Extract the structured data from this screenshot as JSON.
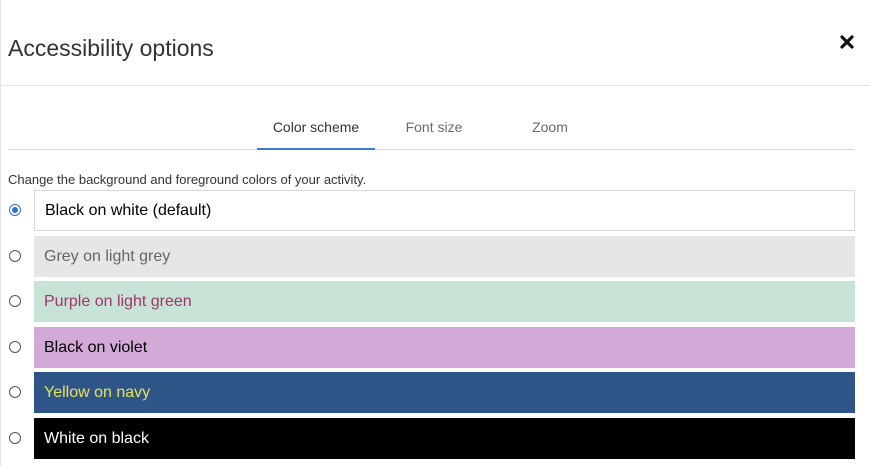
{
  "dialog": {
    "title": "Accessibility options",
    "close_icon": "close-icon"
  },
  "tabs": [
    {
      "label": "Color scheme",
      "active": true
    },
    {
      "label": "Font size",
      "active": false
    },
    {
      "label": "Zoom",
      "active": false
    }
  ],
  "instructions": "Change the background and foreground colors of your activity.",
  "options": [
    {
      "label": "Black on white (default)",
      "selected": true,
      "bg": "#ffffff",
      "fg": "#000000"
    },
    {
      "label": "Grey on light grey",
      "selected": false,
      "bg": "#e6e6e6",
      "fg": "#666666"
    },
    {
      "label": "Purple on light green",
      "selected": false,
      "bg": "#c7e3d5",
      "fg": "#a2336f"
    },
    {
      "label": "Black on violet",
      "selected": false,
      "bg": "#d3a9d8",
      "fg": "#000000"
    },
    {
      "label": "Yellow on navy",
      "selected": false,
      "bg": "#2f5488",
      "fg": "#e4e45a"
    },
    {
      "label": "White on black",
      "selected": false,
      "bg": "#000000",
      "fg": "#ffffff"
    }
  ],
  "colors": {
    "accent": "#3a7bd5",
    "divider": "#d7d7d7"
  }
}
